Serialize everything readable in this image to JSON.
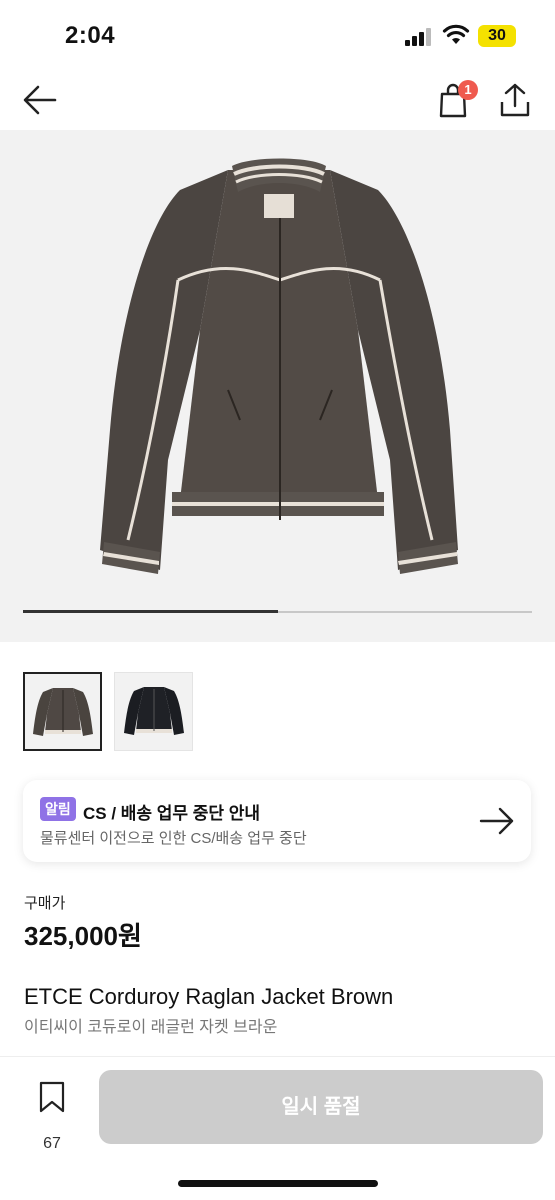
{
  "status_bar": {
    "time": "2:04",
    "battery": "30"
  },
  "nav": {
    "bag_badge": "1",
    "icons": [
      "arrow-left-icon",
      "shopping-bag-icon",
      "share-icon"
    ]
  },
  "hero": {
    "carousel_progress": 0.5
  },
  "notice": {
    "tag": "알림",
    "title": "CS / 배송 업무 중단 안내",
    "subtitle": "물류센터 이전으로 인한 CS/배송 업무 중단"
  },
  "price": {
    "label": "구매가",
    "value": "325,000원"
  },
  "product": {
    "name_en": "ETCE Corduroy Raglan Jacket Brown",
    "name_ko": "이티씨이 코듀로이 래글런 자켓 브라운"
  },
  "bottom": {
    "bookmark_count": "67",
    "buy_label": "일시 품절"
  },
  "colors": {
    "accent": "#8f72e6",
    "badge": "#ef5a4f",
    "disabled_button": "#cccccc",
    "jacket_brown": "#4a4440"
  }
}
